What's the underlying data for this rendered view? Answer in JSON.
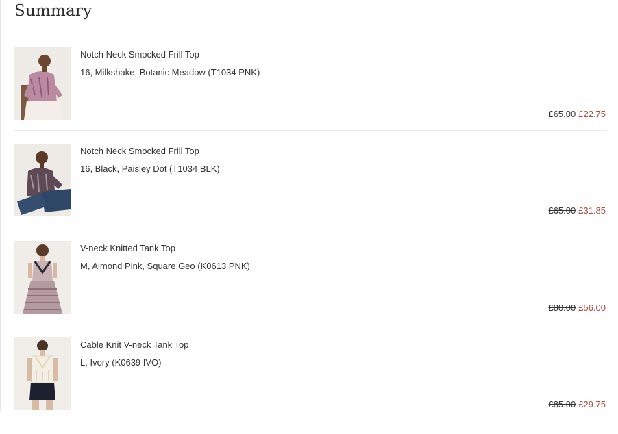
{
  "summary": {
    "title": "Summary"
  },
  "items": [
    {
      "name": "Notch Neck Smocked Frill Top",
      "variant": "16, Milkshake, Botanic Meadow (T1034 PNK)",
      "price_was": "£65.00",
      "price_now": "£22.75"
    },
    {
      "name": "Notch Neck Smocked Frill Top",
      "variant": "16, Black, Paisley Dot (T1034 BLK)",
      "price_was": "£65.00",
      "price_now": "£31.85"
    },
    {
      "name": "V-neck Knitted Tank Top",
      "variant": "M, Almond Pink, Square Geo (K0613 PNK)",
      "price_was": "£80.00",
      "price_now": "£56.00"
    },
    {
      "name": "Cable Knit V-neck Tank Top",
      "variant": "L, Ivory (K0639 IVO)",
      "price_was": "£85.00",
      "price_now": "£29.75"
    }
  ],
  "colors": {
    "sale_price": "#b04a3f",
    "text": "#333333",
    "divider": "#e8e8e8"
  }
}
